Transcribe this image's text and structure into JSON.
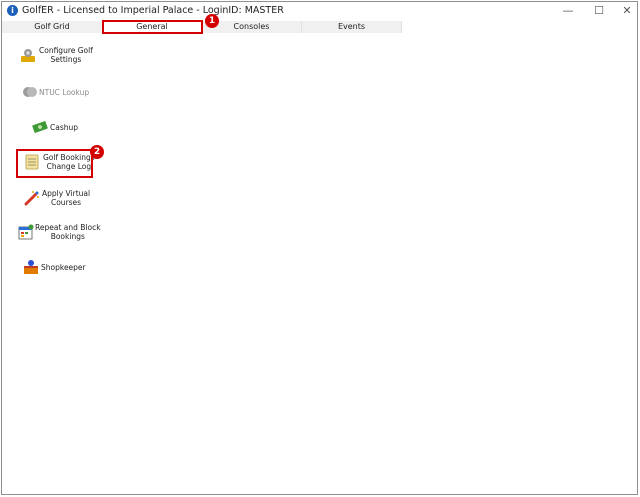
{
  "window": {
    "title": "GolfER - Licensed to Imperial Palace - LoginID: MASTER",
    "minimize": "—",
    "maximize": "☐",
    "close": "✕"
  },
  "tabs": [
    {
      "label": "Golf Grid"
    },
    {
      "label": "General",
      "active": true
    },
    {
      "label": "Consoles"
    },
    {
      "label": "Events"
    }
  ],
  "items": [
    {
      "label_lines": [
        "Configure Golf",
        "Settings"
      ],
      "icon": "gear-icon"
    },
    {
      "label_lines": [
        "NTUC Lookup"
      ],
      "icon": "ntuc-icon",
      "disabled": true
    },
    {
      "label_lines": [
        "Cashup"
      ],
      "icon": "cash-icon"
    },
    {
      "label_lines": [
        "Golf Bookings",
        "Change Log"
      ],
      "icon": "notepad-icon"
    },
    {
      "label_lines": [
        "Apply Virtual",
        "Courses"
      ],
      "icon": "magic-wand-icon"
    },
    {
      "label_lines": [
        "Repeat and Block",
        "Bookings"
      ],
      "icon": "calendar-repeat-icon"
    },
    {
      "label_lines": [
        "Shopkeeper"
      ],
      "icon": "shopkeeper-icon"
    }
  ],
  "annotations": {
    "marker_1": "1",
    "marker_2": "2"
  },
  "colors": {
    "annotation_red": "#d40000",
    "tab_inactive": "#f0f0f0"
  }
}
